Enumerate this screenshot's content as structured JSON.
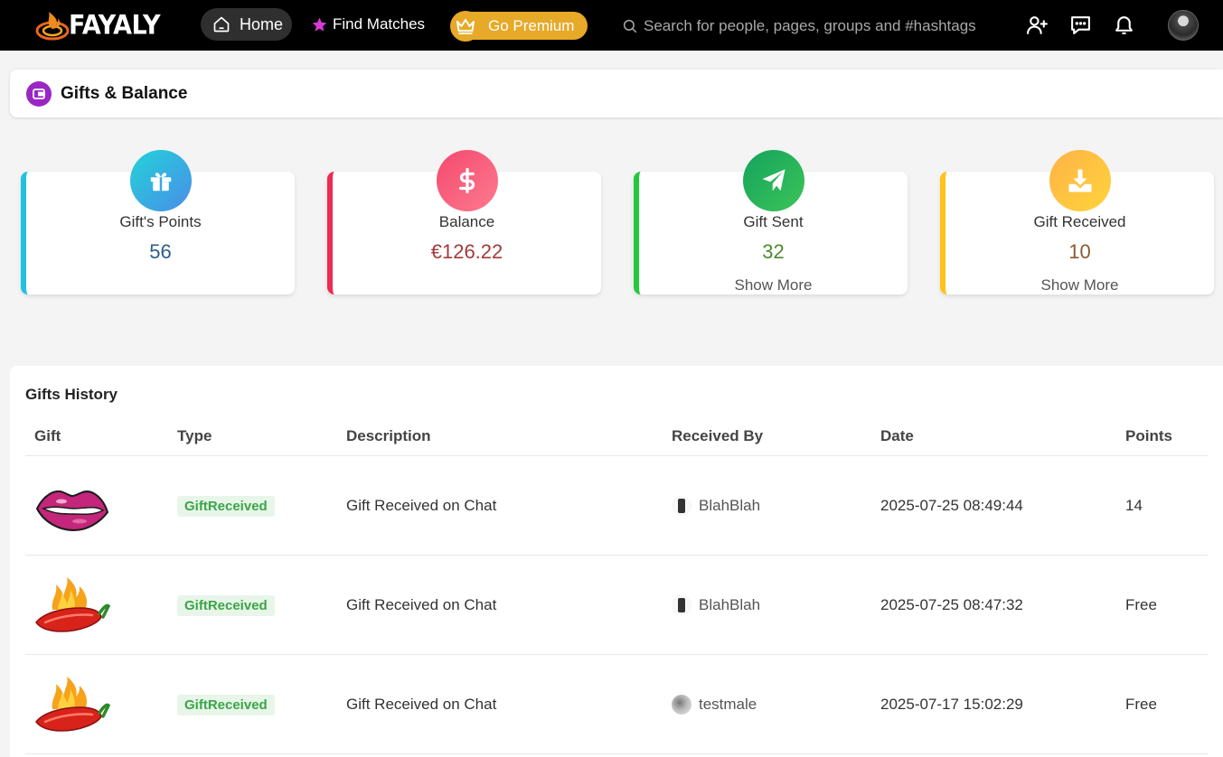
{
  "navbar": {
    "logo_text": "FAYALY",
    "home_label": "Home",
    "find_matches_label": "Find Matches",
    "premium_label": "Go Premium",
    "search_placeholder": "Search for people, pages, groups and #hashtags",
    "icons": [
      "add-friend-icon",
      "messages-icon",
      "notifications-icon"
    ]
  },
  "header": {
    "title": "Gifts & Balance",
    "icon": "wallet-icon"
  },
  "stats": {
    "points": {
      "label": "Gift's Points",
      "value": "56",
      "color": "#2e5d8a",
      "accent": "#21c1e0"
    },
    "balance": {
      "label": "Balance",
      "value": "€126.22",
      "color": "#a23b3b",
      "accent": "#ee2b4f"
    },
    "sent": {
      "label": "Gift Sent",
      "value": "32",
      "more": "Show More",
      "color": "#4d8a2e",
      "accent": "#22c93a"
    },
    "received": {
      "label": "Gift Received",
      "value": "10",
      "more": "Show More",
      "color": "#8a5a2e",
      "accent": "#ffc21a"
    }
  },
  "history": {
    "title": "Gifts History",
    "columns": [
      "Gift",
      "Type",
      "Description",
      "Received By",
      "Date",
      "Points"
    ],
    "rows": [
      {
        "gift": "lips",
        "type": "GiftReceived",
        "description": "Gift Received on Chat",
        "user": "BlahBlah",
        "date": "2025-07-25 08:49:44",
        "points": "14"
      },
      {
        "gift": "hot-pepper",
        "type": "GiftReceived",
        "description": "Gift Received on Chat",
        "user": "BlahBlah",
        "date": "2025-07-25 08:47:32",
        "points": "Free"
      },
      {
        "gift": "hot-pepper",
        "type": "GiftReceived",
        "description": "Gift Received on Chat",
        "user": "testmale",
        "date": "2025-07-17 15:02:29",
        "points": "Free"
      }
    ]
  }
}
